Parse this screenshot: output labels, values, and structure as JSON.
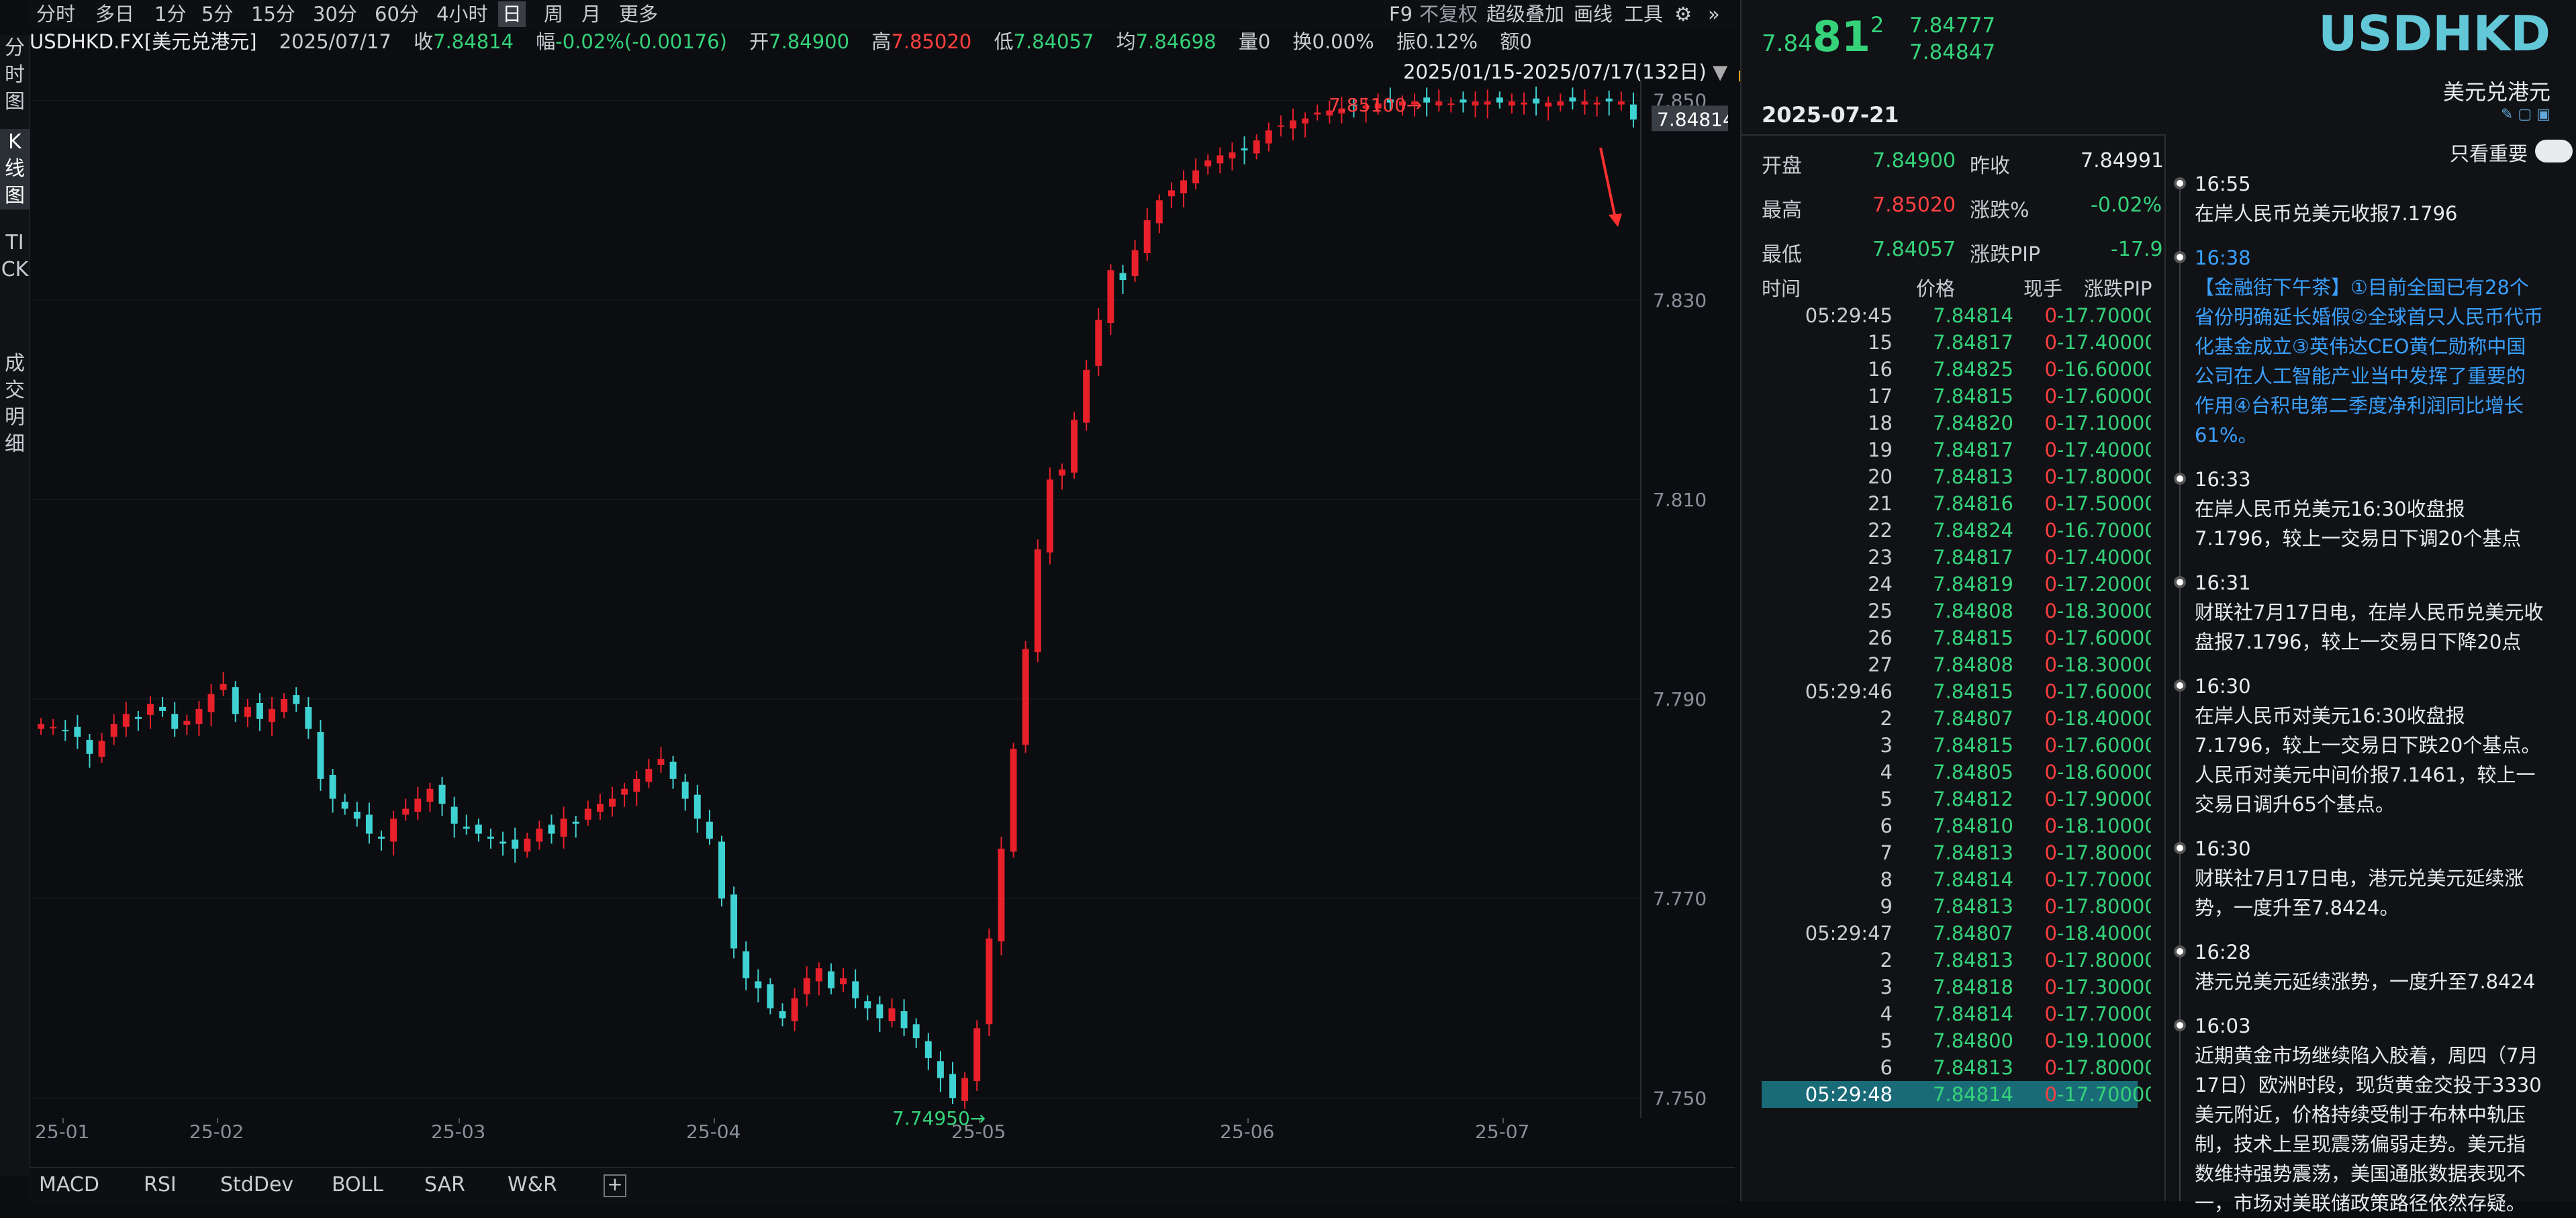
{
  "vertical_tabs": [
    "分时图",
    "K线图",
    "TICK",
    "成交明细"
  ],
  "toolbar": {
    "periods": [
      "分时",
      "多日",
      "1分",
      "5分",
      "15分",
      "30分",
      "60分",
      "4小时",
      "日",
      "周",
      "月",
      "更多"
    ],
    "active_period": "日",
    "right_items": [
      "F9",
      "不复权",
      "超级叠加",
      "画线",
      "工具"
    ]
  },
  "info": {
    "symbol": "USDHKD.FX[美元兑港元]",
    "date": "2025/07/17",
    "close_label": "收",
    "close": "7.84814",
    "change_label": "幅",
    "change": "-0.02%(-0.00176)",
    "open_label": "开",
    "open": "7.84900",
    "high_label": "高",
    "high": "7.85020",
    "low_label": "低",
    "low": "7.84057",
    "avg_label": "均",
    "avg": "7.84698",
    "vol_label": "量",
    "vol": "0",
    "turnover_label": "换",
    "turnover": "0.00%",
    "amp_label": "振",
    "amp": "0.12%",
    "amount_label": "额",
    "amount": "0"
  },
  "range_label": "2025/01/15-2025/07/17(132日)",
  "chart_data": {
    "type": "candlestick",
    "ylim": [
      7.748,
      7.852
    ],
    "yticks": [
      "7.850",
      "7.830",
      "7.810",
      "7.790",
      "7.770",
      "7.750"
    ],
    "xticks": [
      "25-01",
      "25-02",
      "25-03",
      "25-04",
      "25-05",
      "25-06",
      "25-07"
    ],
    "current_price": "7.84814",
    "max_label": "7.85100",
    "min_label": "7.74950",
    "up_color": "#e8202a",
    "down_color": "#3fd2d2",
    "closes": [
      7.7875,
      7.7872,
      7.7868,
      7.7862,
      7.7845,
      7.7858,
      7.7875,
      7.7885,
      7.788,
      7.7895,
      7.7888,
      7.787,
      7.7878,
      7.789,
      7.7905,
      7.7915,
      7.7885,
      7.7892,
      7.788,
      7.789,
      7.79,
      7.7895,
      7.787,
      7.782,
      7.78,
      7.779,
      7.778,
      7.7765,
      7.776,
      7.778,
      7.779,
      7.78,
      7.781,
      7.7795,
      7.7775,
      7.777,
      7.7765,
      7.776,
      7.7755,
      7.775,
      7.776,
      7.777,
      7.7765,
      7.778,
      7.7775,
      7.779,
      7.7795,
      7.78,
      7.781,
      7.782,
      7.783,
      7.784,
      7.782,
      7.78,
      7.778,
      7.776,
      7.77,
      7.765,
      7.762,
      7.761,
      7.759,
      7.758,
      7.76,
      7.762,
      7.763,
      7.761,
      7.762,
      7.76,
      7.759,
      7.758,
      7.759,
      7.757,
      7.756,
      7.754,
      7.752,
      7.75,
      7.752,
      7.757,
      7.766,
      7.775,
      7.785,
      7.795,
      7.805,
      7.812,
      7.813,
      7.818,
      7.823,
      7.828,
      7.833,
      7.832,
      7.835,
      7.838,
      7.84,
      7.841,
      7.842,
      7.843,
      7.844,
      7.8445,
      7.8448,
      7.845,
      7.846,
      7.847,
      7.8475,
      7.848,
      7.8482,
      7.8488,
      7.849,
      7.8492,
      7.8495,
      7.8495,
      7.8497,
      7.8498,
      7.8499,
      7.8499,
      7.8498,
      7.8499,
      7.8497,
      7.8498,
      7.8499,
      7.8499,
      7.8498,
      7.8499,
      7.8498,
      7.8497,
      7.8498,
      7.8499,
      7.8499,
      7.8499,
      7.8498,
      7.8499,
      7.8499,
      7.8481
    ]
  },
  "indicators": [
    "MACD",
    "RSI",
    "StdDev",
    "BOLL",
    "SAR",
    "W&R"
  ],
  "quote": {
    "price_main": "7.84",
    "price_big": "81",
    "price_small": "2",
    "bid": "7.84777",
    "ask": "7.84847",
    "symbol": "USDHKD",
    "name": "美元兑港元",
    "date": "2025-07-21",
    "open_label": "开盘",
    "open": "7.84900",
    "prevclose_label": "昨收",
    "prevclose": "7.84991",
    "high_label": "最高",
    "high": "7.85020",
    "chgpct_label": "涨跌%",
    "chgpct": "-0.02%",
    "low_label": "最低",
    "low": "7.84057",
    "chgpip_label": "涨跌PIP",
    "chgpip": "-17.9"
  },
  "ticks_header": [
    "时间",
    "价格",
    "现手",
    "涨跌PIP"
  ],
  "ticks": [
    [
      "05:29:45",
      "7.84814",
      "0",
      "-17.70000"
    ],
    [
      "15",
      "7.84817",
      "0",
      "-17.40000"
    ],
    [
      "16",
      "7.84825",
      "0",
      "-16.60000"
    ],
    [
      "17",
      "7.84815",
      "0",
      "-17.60000"
    ],
    [
      "18",
      "7.84820",
      "0",
      "-17.10000"
    ],
    [
      "19",
      "7.84817",
      "0",
      "-17.40000"
    ],
    [
      "20",
      "7.84813",
      "0",
      "-17.80000"
    ],
    [
      "21",
      "7.84816",
      "0",
      "-17.50000"
    ],
    [
      "22",
      "7.84824",
      "0",
      "-16.70000"
    ],
    [
      "23",
      "7.84817",
      "0",
      "-17.40000"
    ],
    [
      "24",
      "7.84819",
      "0",
      "-17.20000"
    ],
    [
      "25",
      "7.84808",
      "0",
      "-18.30000"
    ],
    [
      "26",
      "7.84815",
      "0",
      "-17.60000"
    ],
    [
      "27",
      "7.84808",
      "0",
      "-18.30000"
    ],
    [
      "05:29:46",
      "7.84815",
      "0",
      "-17.60000"
    ],
    [
      "2",
      "7.84807",
      "0",
      "-18.40000"
    ],
    [
      "3",
      "7.84815",
      "0",
      "-17.60000"
    ],
    [
      "4",
      "7.84805",
      "0",
      "-18.60000"
    ],
    [
      "5",
      "7.84812",
      "0",
      "-17.90000"
    ],
    [
      "6",
      "7.84810",
      "0",
      "-18.10000"
    ],
    [
      "7",
      "7.84813",
      "0",
      "-17.80000"
    ],
    [
      "8",
      "7.84814",
      "0",
      "-17.70000"
    ],
    [
      "9",
      "7.84813",
      "0",
      "-17.80000"
    ],
    [
      "05:29:47",
      "7.84807",
      "0",
      "-18.40000"
    ],
    [
      "2",
      "7.84813",
      "0",
      "-17.80000"
    ],
    [
      "3",
      "7.84818",
      "0",
      "-17.30000"
    ],
    [
      "4",
      "7.84814",
      "0",
      "-17.70000"
    ],
    [
      "5",
      "7.84800",
      "0",
      "-19.10000"
    ],
    [
      "6",
      "7.84813",
      "0",
      "-17.80000"
    ],
    [
      "05:29:48",
      "7.84814",
      "0",
      "-17.70000"
    ]
  ],
  "news_toggle": "只看重要",
  "news": [
    {
      "time": "16:55",
      "text": "在岸人民币兑美元收报7.1796",
      "blue": false
    },
    {
      "time": "16:38",
      "text": "【金融街下午茶】①目前全国已有28个省份明确延长婚假②全球首只人民币代币化基金成立③英伟达CEO黄仁勋称中国公司在人工智能产业当中发挥了重要的作用④台积电第二季度净利润同比增长61%。",
      "blue": true
    },
    {
      "time": "16:33",
      "text": "在岸人民币兑美元16:30收盘报7.1796，较上一交易日下调20个基点",
      "blue": false
    },
    {
      "time": "16:31",
      "text": "财联社7月17日电，在岸人民币兑美元收盘报7.1796，较上一交易日下降20点",
      "blue": false
    },
    {
      "time": "16:30",
      "text": "在岸人民币对美元16:30收盘报7.1796，较上一交易日下跌20个基点。人民币对美元中间价报7.1461，较上一交易日调升65个基点。",
      "blue": false
    },
    {
      "time": "16:30",
      "text": "财联社7月17日电，港元兑美元延续涨势，一度升至7.8424。",
      "blue": false
    },
    {
      "time": "16:28",
      "text": "港元兑美元延续涨势，一度升至7.8424",
      "blue": false
    },
    {
      "time": "16:03",
      "text": "近期黄金市场继续陷入胶着，周四（7月17日）欧洲时段，现货黄金交投于3330美元附近，价格持续受制于布林中轨压制，技术上呈现震荡偏弱走势。美元指数维持强势震荡，美国通胀数据表现不一，市场对美联储政策路径依然存疑。",
      "blue": false
    }
  ]
}
